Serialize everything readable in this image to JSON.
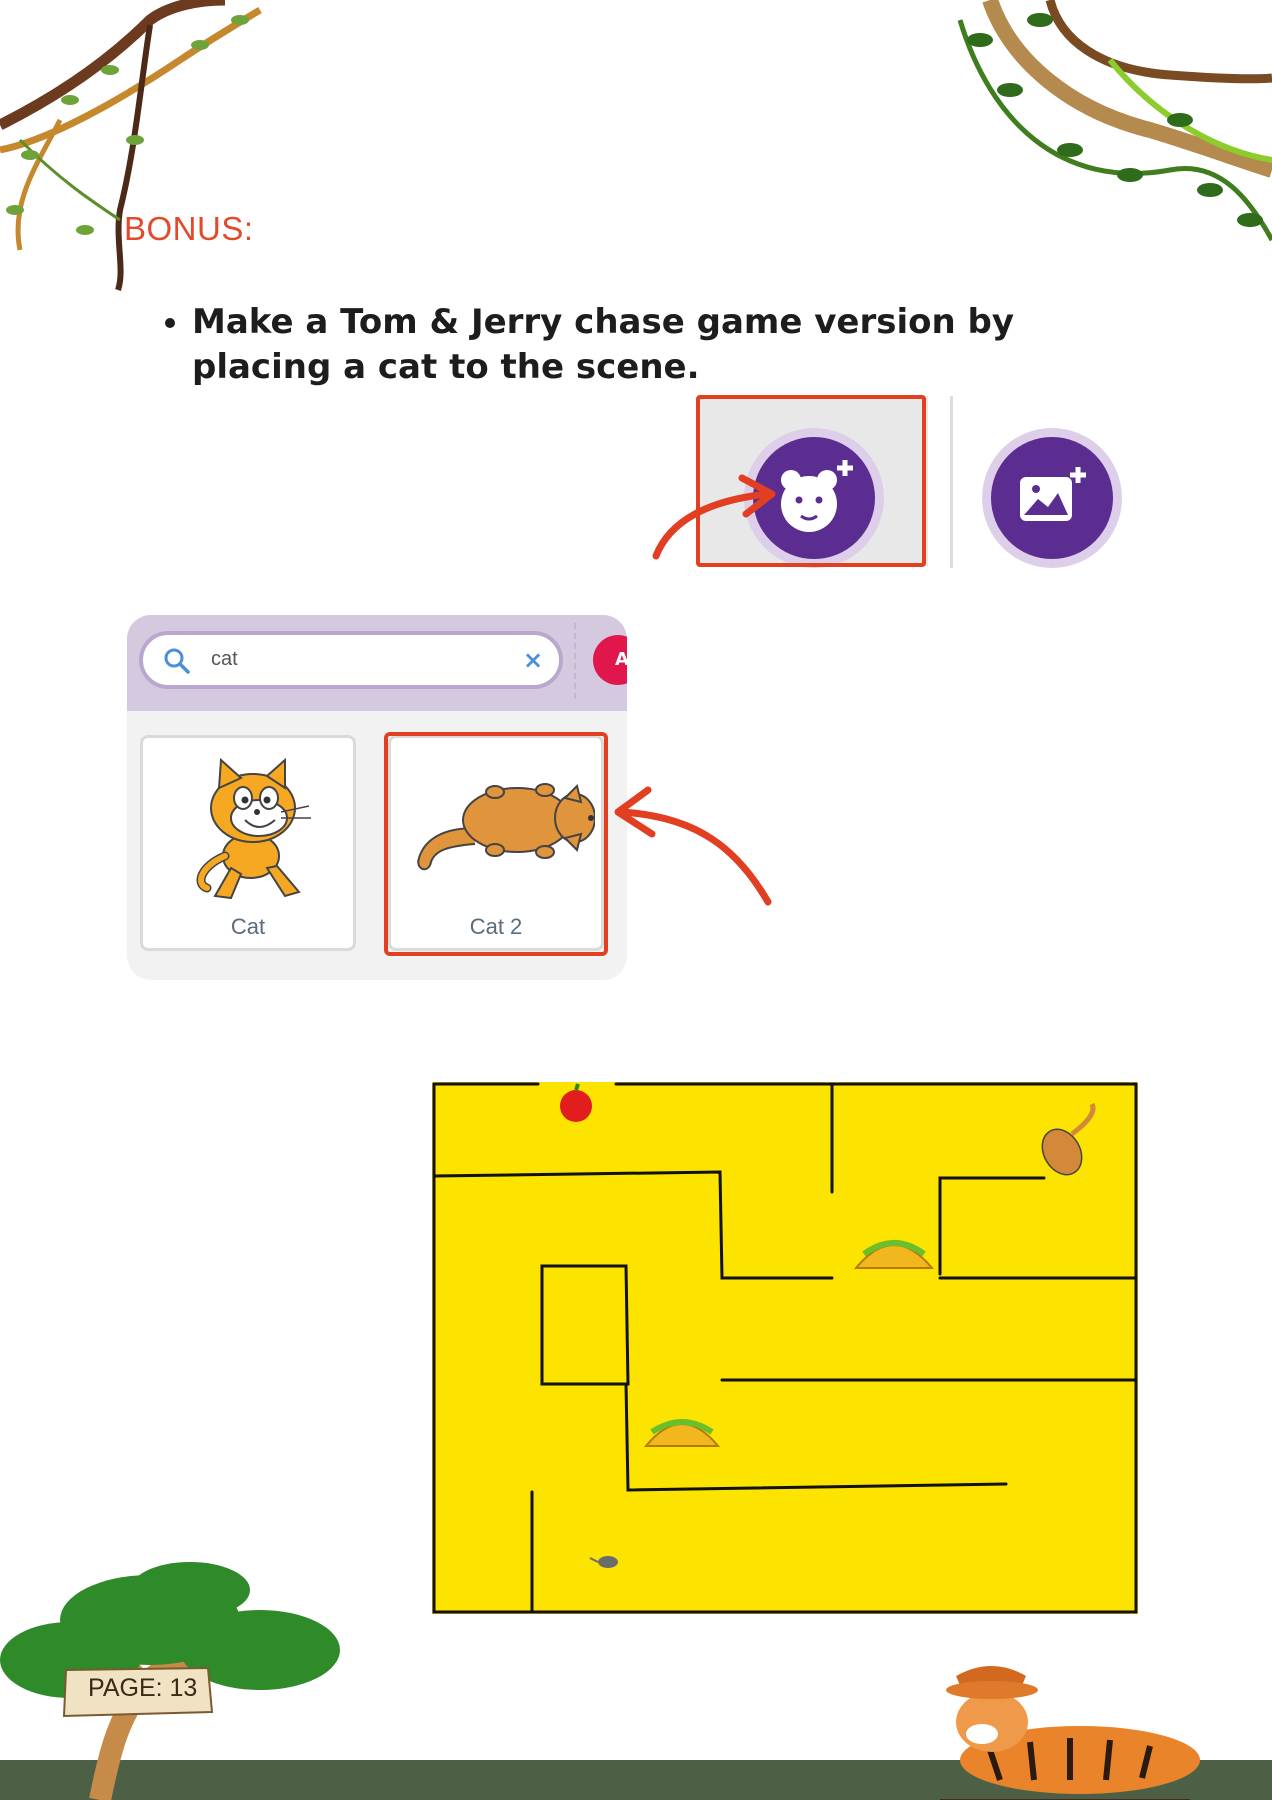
{
  "heading": "BONUS:",
  "instruction": "Make a Tom & Jerry chase game version by placing a cat to the scene.",
  "sprite_picker": {
    "search_value": "cat",
    "clear_icon": "×",
    "badge_letter": "A",
    "tiles": [
      {
        "label": "Cat"
      },
      {
        "label": "Cat 2"
      }
    ]
  },
  "toolbar": {
    "buttons": [
      {
        "icon": "choose-sprite-icon",
        "highlighted": true
      },
      {
        "icon": "choose-backdrop-icon",
        "highlighted": false
      }
    ]
  },
  "maze": {
    "background_color": "#fde300"
  },
  "footer": {
    "page_label": "PAGE: 13"
  },
  "colors": {
    "accent_red": "#e24a2c",
    "scratch_purple": "#5c2d91"
  }
}
